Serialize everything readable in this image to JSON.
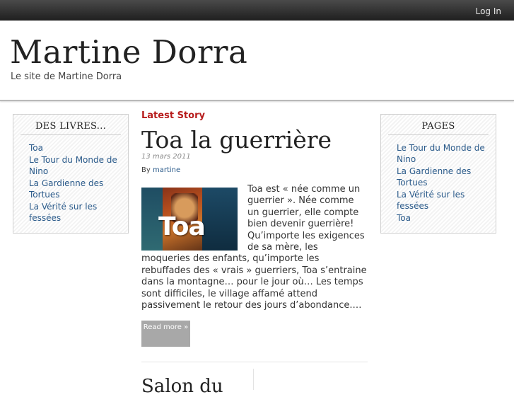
{
  "topbar": {
    "login_label": "Log In"
  },
  "header": {
    "site_title": "Martine Dorra",
    "tagline": "Le site de Martine Dorra"
  },
  "left_widget": {
    "title": "DES LIVRES...",
    "items": [
      "Toa",
      "Le Tour du Monde de Nino",
      "La Gardienne des Tortues",
      "La Vérité sur les fessées"
    ]
  },
  "right_widget": {
    "title": "PAGES",
    "items": [
      "Le Tour du Monde de Nino",
      "La Gardienne des Tortues",
      "La Vérité sur les fessées",
      "Toa"
    ]
  },
  "main": {
    "section_label": "Latest Story",
    "post": {
      "title": "Toa la guerrière",
      "date": "13 mars 2011",
      "by_label": "By",
      "author": "martine",
      "thumbnail_text": "Toa",
      "excerpt": "Toa est « née comme un guerrier ». Née comme un guerrier, elle compte bien devenir guerrière! Qu’importe les exigences de sa mère, les moqueries des enfants, qu’importe les rebuffades des « vrais » guerriers, Toa s’entraine dans la montagne… pour le jour où… Les temps sont difficiles, le village affamé attend passivement le retour des jours d’abondance.…",
      "read_more_label": "Read more »"
    },
    "next_post_title": "Salon du"
  },
  "colors": {
    "accent": "#b71c1c",
    "link": "#2a5a8a",
    "topbar": "#2b2b2b"
  }
}
